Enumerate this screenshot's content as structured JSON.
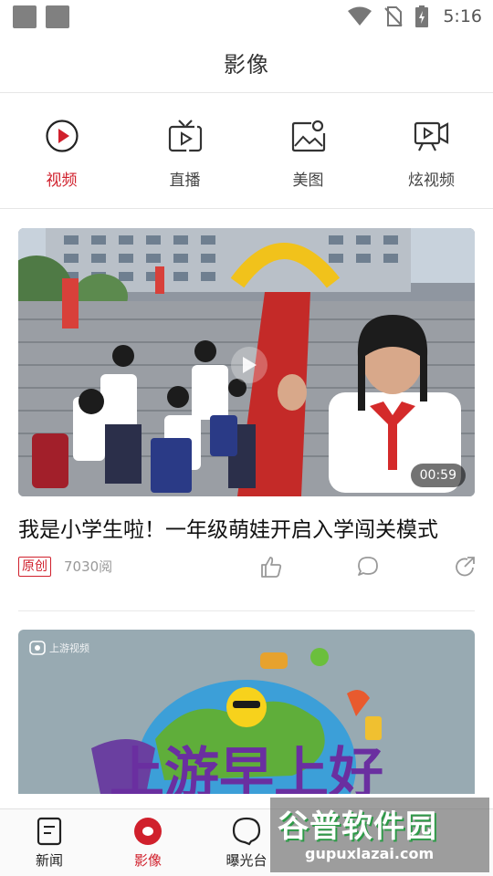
{
  "status_bar": {
    "time": "5:16"
  },
  "header": {
    "title": "影像"
  },
  "categories": [
    {
      "label": "视频",
      "icon": "play-circle-icon",
      "active": true
    },
    {
      "label": "直播",
      "icon": "tv-play-icon",
      "active": false
    },
    {
      "label": "美图",
      "icon": "image-icon",
      "active": false
    },
    {
      "label": "炫视频",
      "icon": "video-camera-icon",
      "active": false
    }
  ],
  "feed": [
    {
      "title": "我是小学生啦！一年级萌娃开启入学闯关模式",
      "duration": "00:59",
      "badge": "原创",
      "reads": "7030阅"
    },
    {
      "source_logo": "上游视频",
      "headline_art": "上游早上好"
    }
  ],
  "bottom_nav": [
    {
      "label": "新闻",
      "icon": "news-icon",
      "active": false
    },
    {
      "label": "影像",
      "icon": "record-icon",
      "active": true
    },
    {
      "label": "曝光台",
      "icon": "bubble-icon",
      "active": false
    }
  ],
  "watermark": {
    "text": "谷普软件园",
    "url": "gupuxlazai.com"
  },
  "colors": {
    "accent": "#d0202c",
    "text": "#222222",
    "muted": "#999999"
  }
}
